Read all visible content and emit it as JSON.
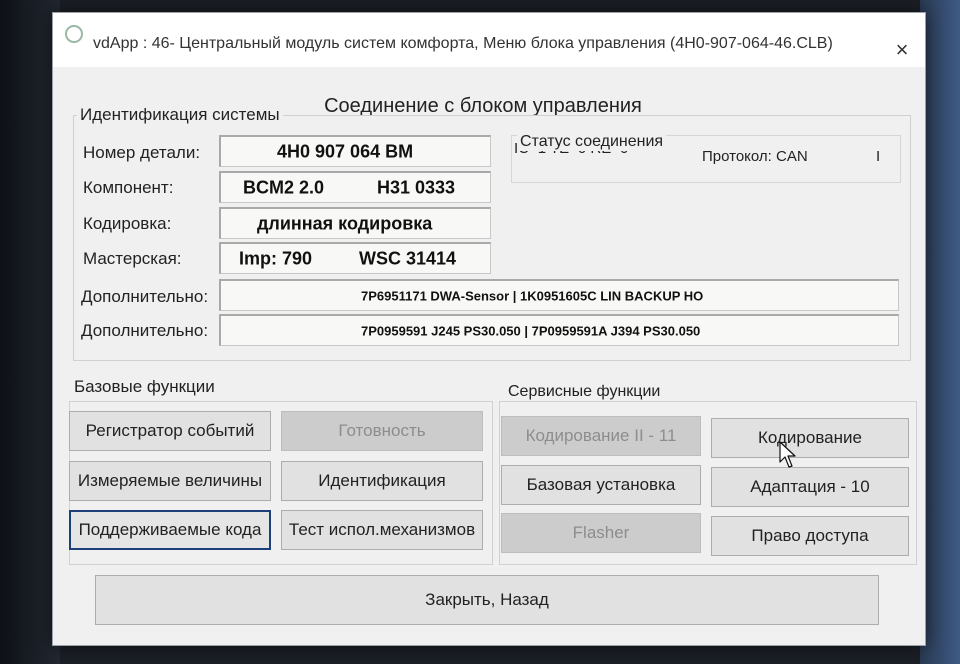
{
  "window": {
    "title": "vdApp : 46- Центральный модуль систем комфорта,  Меню блока управления (4H0-907-064-46.CLB)",
    "close_icon": "×"
  },
  "main": {
    "heading": "Соединение с блоком управления"
  },
  "identification": {
    "group_label": "Идентификация системы",
    "rows": [
      {
        "label": "Номер детали:",
        "value": "4H0 907 064 BM"
      },
      {
        "label": "Компонент:",
        "value_a": "BCM2 2.0",
        "value_b": "H31 0333"
      },
      {
        "label": "Кодировка:",
        "value": "длинная кодировка"
      },
      {
        "label": "Мастерская:",
        "value_a": "Imp: 790",
        "value_b": "WSC 31414"
      }
    ],
    "extra": [
      {
        "label": "Дополнительно:",
        "value": "7P6951171  DWA-Sensor  |  1K0951605C LIN BACKUP HO"
      },
      {
        "label": "Дополнительно:",
        "value": "7P0959591  J245 PS30.050  |  7P0959591A J394 PS30.050"
      }
    ]
  },
  "connection_status": {
    "label": "Статус соединения",
    "counters": "IC=1  TE=0   RE=0",
    "protocol": "Протокол: CAN",
    "indicator": "I"
  },
  "base_functions": {
    "label": "Базовые функции",
    "buttons": {
      "event_recorder": "Регистратор событий",
      "readiness": "Готовность",
      "measured_values": "Измеряемые величины",
      "identification": "Идентификация",
      "supported_codes": "Поддерживаемые кода",
      "output_test": "Тест испол.механизмов"
    }
  },
  "service_functions": {
    "label": "Сервисные функции",
    "buttons": {
      "coding_ii": "Кодирование II - 11",
      "coding": "Кодирование",
      "basic_settings": "Базовая установка",
      "adaptation": "Адаптация - 10",
      "flasher": "Flasher",
      "access": "Право доступа"
    }
  },
  "footer": {
    "close_back": "Закрыть, Назад"
  }
}
